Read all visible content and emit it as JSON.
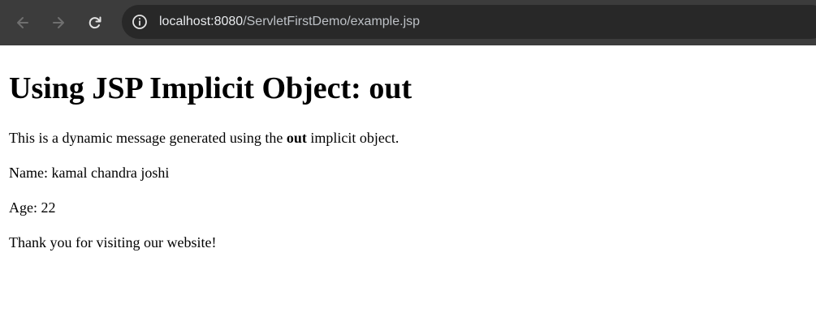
{
  "browser": {
    "url_host": "localhost:8080",
    "url_path": "/ServletFirstDemo/example.jsp",
    "icons": {
      "back": "back-arrow-icon",
      "forward": "forward-arrow-icon",
      "reload": "reload-icon",
      "site_info": "info-icon"
    },
    "colors": {
      "toolbar": "#3c3c3c",
      "omnibox": "#282828"
    }
  },
  "page": {
    "heading": "Using JSP Implicit Object: out",
    "message_before": "This is a dynamic message generated using the ",
    "message_bold": "out",
    "message_after": " implicit object.",
    "name_line": "Name: kamal chandra joshi",
    "age_line": "Age: 22",
    "thanks_line": "Thank you for visiting our website!"
  }
}
